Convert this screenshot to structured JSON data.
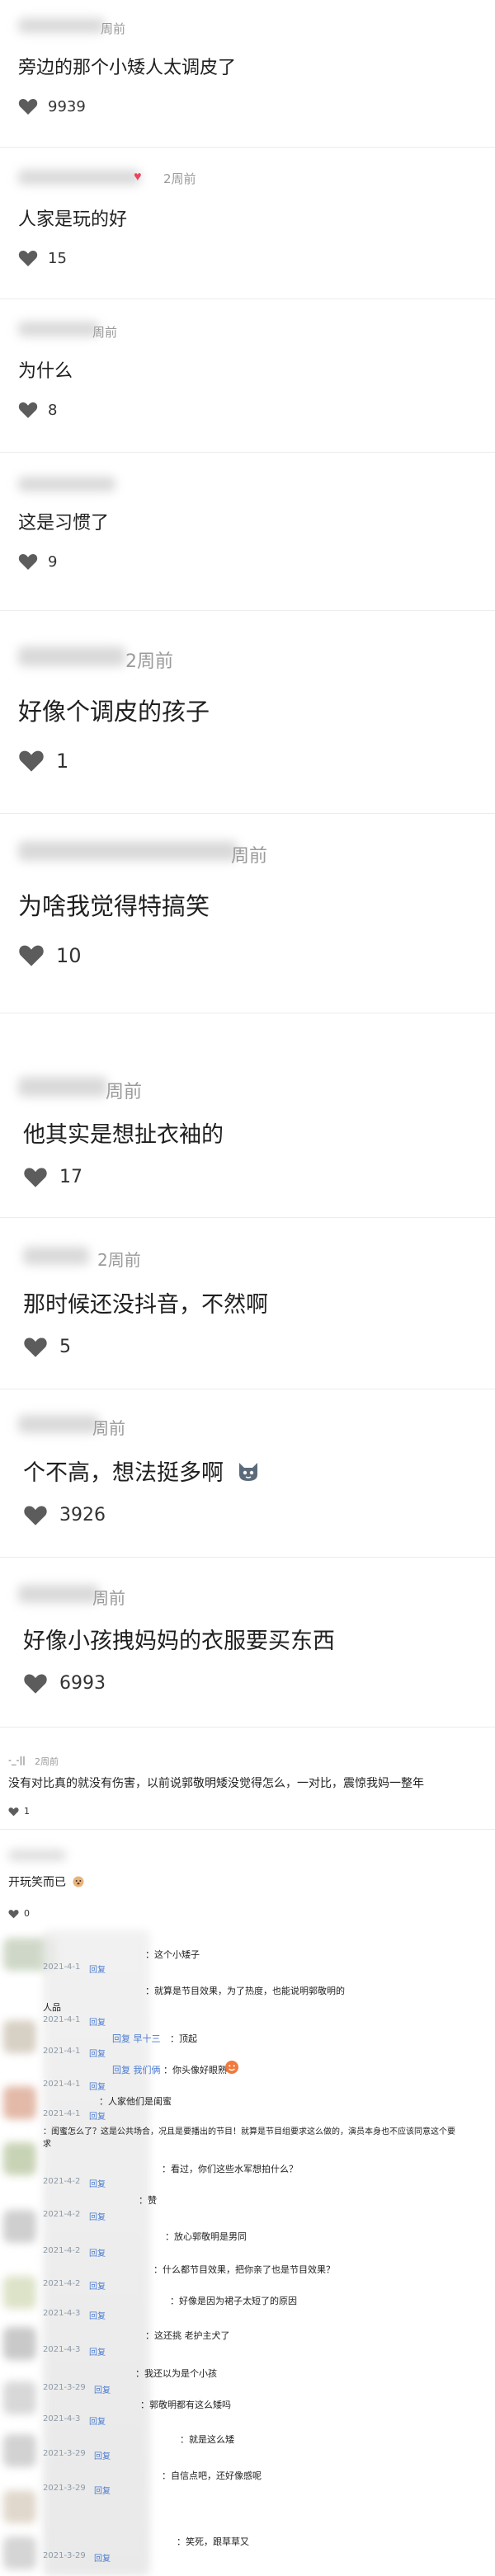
{
  "comments": [
    {
      "time": "周前",
      "text": "旁边的那个小矮人太调皮了",
      "likes": "9939"
    },
    {
      "time": "2周前",
      "text": "人家是玩的好",
      "likes": "15"
    },
    {
      "time": "周前",
      "text": "为什么",
      "likes": "8"
    },
    {
      "time": "",
      "text": "这是习惯了",
      "likes": "9"
    },
    {
      "time": "2周前",
      "text": "好像个调皮的孩子",
      "likes": "1"
    },
    {
      "time": "周前",
      "text": "为啥我觉得特搞笑",
      "likes": "10"
    },
    {
      "time": "周前",
      "text": "他其实是想扯衣袖的",
      "likes": "17"
    },
    {
      "time": "2周前",
      "text": "那时候还没抖音，不然啊",
      "likes": "5"
    },
    {
      "time": "周前",
      "text": "个不高，想法挺多啊",
      "likes": "3926"
    },
    {
      "time": "周前",
      "text": "好像小孩拽妈妈的衣服要买东西",
      "likes": "6993"
    },
    {
      "time": "2周前",
      "text": "没有对比真的就没有伤害，以前说郭敬明矮没觉得怎么，一对比，震惊我妈一整年",
      "likes": "1"
    },
    {
      "time": "",
      "text": "开玩笑而已",
      "likes": "0"
    }
  ],
  "chat": [
    {
      "name": "",
      "text": "：这个小矮子",
      "time": "2021-4-1",
      "reply": "回复"
    },
    {
      "name": "",
      "text": "：就算是节目效果，为了热度，也能说明郭敬明的",
      "time": "",
      "reply": ""
    },
    {
      "name": "",
      "text": "人品",
      "time": "2021-4-1",
      "reply": "回复"
    },
    {
      "name": "回复 早十三",
      "text": "：顶起",
      "time": "2021-4-1",
      "reply": "回复"
    },
    {
      "name": "回复 我们俩",
      "text": "：你头像好眼熟",
      "time": "2021-4-1",
      "reply": "回复"
    },
    {
      "name": "",
      "text": "：人家他们是闺蜜",
      "time": "2021-4-1",
      "reply": "回复"
    },
    {
      "name": "",
      "text": "：闺蜜怎么了？这是公共场合，况且是要播出的节目！就算是节目组要求这么做的，演员本身也不应该同意这个要求",
      "time": "",
      "reply": ""
    },
    {
      "name": "",
      "text": "：看过，你们这些水军想拍什么？",
      "time": "2021-4-2",
      "reply": "回复"
    },
    {
      "name": "",
      "text": "：赞",
      "time": "2021-4-2",
      "reply": "回复"
    },
    {
      "name": "",
      "text": "：放心郭敬明是男同",
      "time": "2021-4-2",
      "reply": "回复"
    },
    {
      "name": "",
      "text": "：什么都节目效果，把你亲了也是节目效果？",
      "time": "2021-4-2",
      "reply": "回复"
    },
    {
      "name": "",
      "text": "：好像是因为裙子太短了的原因",
      "time": "2021-4-3",
      "reply": "回复"
    },
    {
      "name": "",
      "text": "：这还挑 老护主犬了",
      "time": "2021-4-3",
      "reply": "回复"
    },
    {
      "name": "",
      "text": "：我还以为是个小孩",
      "time": "2021-3-29",
      "reply": "回复"
    },
    {
      "name": "",
      "text": "：郭敬明都有这么矮吗",
      "time": "2021-4-3",
      "reply": "回复"
    },
    {
      "name": "",
      "text": "：就是这么矮",
      "time": "2021-3-29",
      "reply": "回复"
    },
    {
      "name": "",
      "text": "：自信点吧，还好像感呢",
      "time": "2021-3-29",
      "reply": "回复"
    },
    {
      "name": "",
      "text": "：笑死，跟草草又",
      "time": "2021-3-29",
      "reply": "回复"
    }
  ],
  "colors": {
    "heart": "#5c5c5c",
    "reply": "#4a7bd0",
    "meta": "#9b9b9b"
  },
  "icons": {
    "like": "heart-icon"
  }
}
